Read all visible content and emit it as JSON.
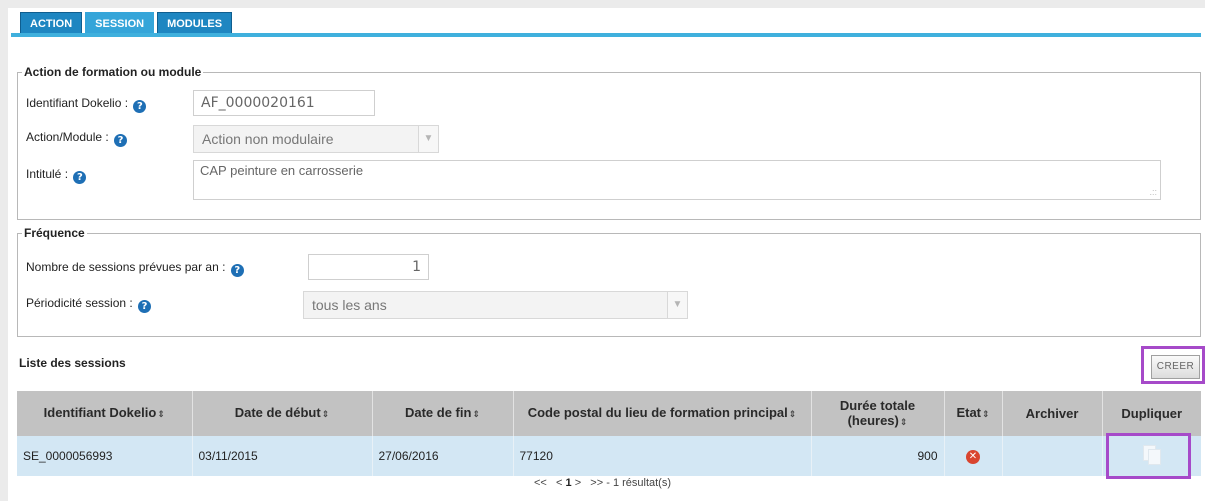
{
  "tabs": [
    {
      "label": "ACTION"
    },
    {
      "label": "SESSION"
    },
    {
      "label": "MODULES"
    }
  ],
  "action_fieldset": {
    "legend": "Action de formation ou module",
    "identifiant_label": "Identifiant Dokelio :",
    "identifiant_value": "AF_0000020161",
    "action_module_label": "Action/Module :",
    "action_module_value": "Action non modulaire",
    "intitule_label": "Intitulé :",
    "intitule_value": "CAP peinture en carrosserie"
  },
  "frequence_fieldset": {
    "legend": "Fréquence",
    "nb_sessions_label": "Nombre de sessions prévues par an :",
    "nb_sessions_value": "1",
    "periodicite_label": "Périodicité session :",
    "periodicite_value": "tous les ans"
  },
  "sessions": {
    "title": "Liste des sessions",
    "create_label": "CREER",
    "columns": [
      {
        "label": "Identifiant Dokelio",
        "sortable": true
      },
      {
        "label": "Date de début",
        "sortable": true
      },
      {
        "label": "Date de fin",
        "sortable": true
      },
      {
        "label": "Code postal du lieu de formation principal",
        "sortable": true
      },
      {
        "label": "Durée totale (heures)",
        "sortable": true
      },
      {
        "label": "Etat",
        "sortable": true
      },
      {
        "label": "Archiver",
        "sortable": false
      },
      {
        "label": "Dupliquer",
        "sortable": false
      }
    ],
    "rows": [
      {
        "identifiant": "SE_0000056993",
        "date_debut": "03/11/2015",
        "date_fin": "27/06/2016",
        "code_postal": "77120",
        "duree": "900",
        "etat_icon": "error-x-icon",
        "dupliquer_icon": "duplicate-pages-icon"
      }
    ],
    "pager": {
      "prev_all": "<<",
      "prev": "<",
      "page": "1",
      "next": ">",
      "next_all": ">>",
      "result_text": "- 1 résultat(s)"
    }
  },
  "help_icon_glyph": "?",
  "sort_glyph": "⇕",
  "etat_glyph": "✕",
  "colors": {
    "tab": "#1e86c1",
    "tab_active": "#35a5d9",
    "header_bg": "#c2c2c2",
    "row_bg": "#d3e7f4",
    "highlight": "#a64ac9"
  }
}
